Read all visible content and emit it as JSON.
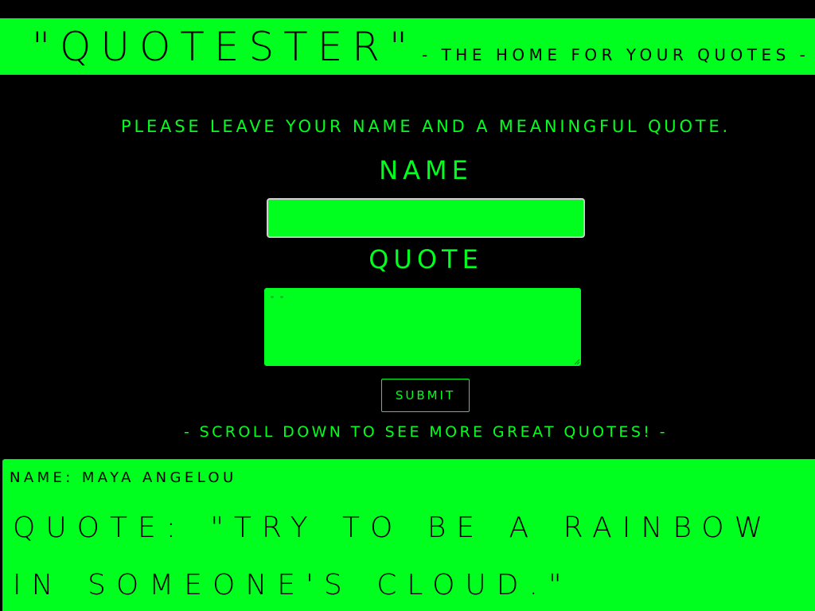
{
  "header": {
    "title": "\"QUOTESTER\"",
    "tagline": "- THE HOME FOR YOUR QUOTES -"
  },
  "form": {
    "intro": "PLEASE LEAVE YOUR NAME AND A MEANINGFUL QUOTE.",
    "name_label": "NAME",
    "name_value": "",
    "quote_label": "QUOTE",
    "quote_placeholder": "\" \"",
    "submit_label": "SUBMIT"
  },
  "scroll_hint": "- SCROLL DOWN TO SEE MORE GREAT QUOTES! -",
  "quotes": [
    {
      "name_line": "NAME: MAYA ANGELOU",
      "quote_line": "QUOTE: \"TRY TO BE A RAINBOW IN SOMEONE'S CLOUD.\""
    }
  ],
  "colors": {
    "background": "#000000",
    "accent": "#00ff1e",
    "text_on_accent": "#000000"
  },
  "icons": {
    "textarea_resize": "resize-grip-icon"
  }
}
